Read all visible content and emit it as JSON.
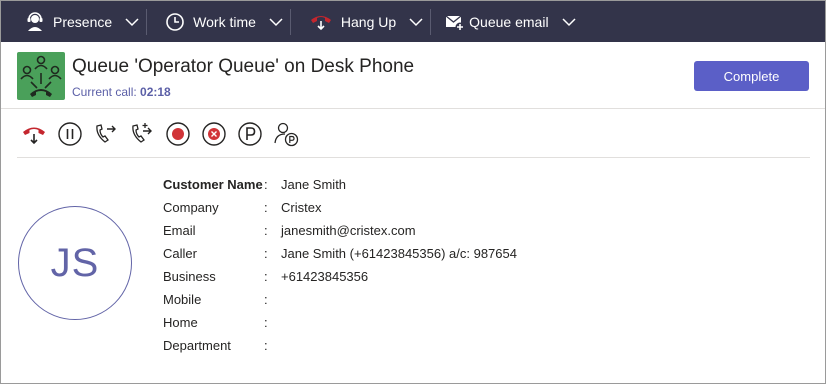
{
  "toolbar": {
    "presence_label": "Presence",
    "work_time_label": "Work time",
    "hang_up_label": "Hang Up",
    "queue_email_label": "Queue email",
    "colors": {
      "background": "#33344a",
      "hang_up_icon": "#c4262e"
    }
  },
  "header": {
    "title": "Queue 'Operator Queue' on Desk Phone",
    "current_call_label": "Current call:",
    "current_call_time": "02:18",
    "complete_label": "Complete",
    "colors": {
      "complete_button": "#5b5fc7",
      "queue_tile": "#4aa05a"
    }
  },
  "actions": [
    {
      "icon": "hang-up-icon"
    },
    {
      "icon": "hold-icon"
    },
    {
      "icon": "transfer-icon"
    },
    {
      "icon": "consult-transfer-icon"
    },
    {
      "icon": "record-icon"
    },
    {
      "icon": "stop-record-icon"
    },
    {
      "icon": "park-icon"
    },
    {
      "icon": "park-to-user-icon"
    }
  ],
  "contact": {
    "initials": "JS",
    "fields": [
      {
        "label": "Customer Name",
        "value": "Jane Smith"
      },
      {
        "label": "Company",
        "value": "Cristex"
      },
      {
        "label": "Email",
        "value": "janesmith@cristex.com"
      },
      {
        "label": "Caller",
        "value": "Jane Smith (+61423845356) a/c: 987654"
      },
      {
        "label": "Business",
        "value": "+61423845356"
      },
      {
        "label": "Mobile",
        "value": ""
      },
      {
        "label": "Home",
        "value": ""
      },
      {
        "label": "Department",
        "value": ""
      }
    ],
    "separator": ":"
  }
}
